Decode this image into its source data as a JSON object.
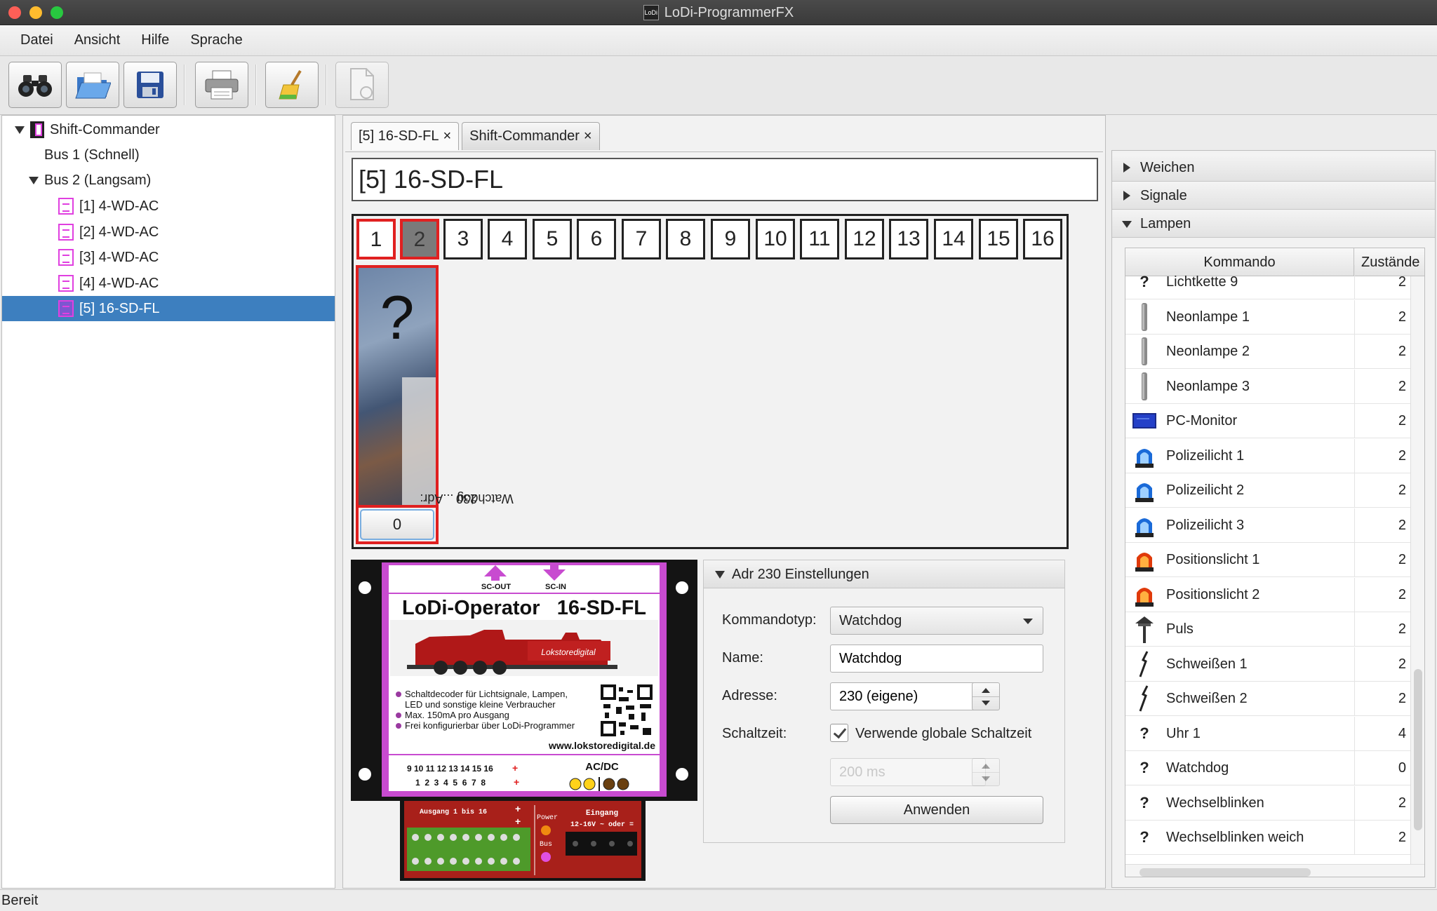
{
  "window": {
    "title": "LoDi-ProgrammerFX",
    "app_icon_text": "LoDi"
  },
  "menu": [
    "Datei",
    "Ansicht",
    "Hilfe",
    "Sprache"
  ],
  "toolbar": {
    "icons": [
      "binoculars-icon",
      "open-folder-icon",
      "save-disk-icon",
      "printer-icon",
      "broom-clean-icon",
      "document-refresh-icon"
    ]
  },
  "tree": [
    {
      "label": "Shift-Commander",
      "level": 0,
      "expanded": true
    },
    {
      "label": "Bus 1 (Schnell)",
      "level": 1
    },
    {
      "label": "Bus 2 (Langsam)",
      "level": 1,
      "expanded": true
    },
    {
      "label": "[1] 4-WD-AC",
      "level": 2
    },
    {
      "label": "[2] 4-WD-AC",
      "level": 2
    },
    {
      "label": "[3] 4-WD-AC",
      "level": 2
    },
    {
      "label": "[4] 4-WD-AC",
      "level": 2
    },
    {
      "label": "[5] 16-SD-FL",
      "level": 2,
      "selected": true
    }
  ],
  "tabs": [
    {
      "label": "[5] 16-SD-FL",
      "active": true,
      "close": "×"
    },
    {
      "label": "Shift-Commander",
      "active": false,
      "close": "×"
    }
  ],
  "module_title": "[5] 16-SD-FL",
  "channels": [
    "1",
    "2",
    "3",
    "4",
    "5",
    "6",
    "7",
    "8",
    "9",
    "10",
    "11",
    "12",
    "13",
    "14",
    "15",
    "16"
  ],
  "selected_channel": "1",
  "output": {
    "symbol": "?",
    "label_line1": "Watchdog ...Adr:",
    "label_line2": "230",
    "state_button": "0"
  },
  "product": {
    "sc_out": "SC-OUT",
    "sc_in": "SC-IN",
    "title": "LoDi-Operator   16-SD-FL",
    "brand": "Lokstoredigital",
    "bullets": [
      "Schaltdecoder für Lichtsignale, Lampen,",
      "LED und sonstige kleine Verbraucher",
      "Max. 150mA pro Ausgang",
      "Frei konfigurierbar über LoDi-Programmer"
    ],
    "url": "www.lokstoredigital.de",
    "pins_top": "9 10 11 12 13 14 15 16",
    "pins_bottom": "1  2  3  4  5  6  7  8",
    "acdc": "AC/DC",
    "ausgang": "Ausgang 1 bis 16",
    "power": "Power",
    "bus": "Bus",
    "eingang": "Eingang",
    "eingang_sub": "12-16V ~ oder ="
  },
  "settings": {
    "header": "Adr 230 Einstellungen",
    "kommandotyp_label": "Kommandotyp:",
    "kommandotyp_value": "Watchdog",
    "name_label": "Name:",
    "name_value": "Watchdog",
    "adresse_label": "Adresse:",
    "adresse_value": "230 (eigene)",
    "schaltzeit_label": "Schaltzeit:",
    "global_checkbox_label": "Verwende globale Schaltzeit",
    "global_checked": true,
    "schaltzeit_value": "200 ms",
    "apply_label": "Anwenden"
  },
  "right_panel": {
    "sections": [
      {
        "label": "Weichen",
        "expanded": false
      },
      {
        "label": "Signale",
        "expanded": false
      },
      {
        "label": "Lampen",
        "expanded": true
      }
    ],
    "columns": [
      "Kommando",
      "Zustände"
    ],
    "rows": [
      {
        "icon": "question-icon",
        "name": "Lichtkette 9",
        "states": "2"
      },
      {
        "icon": "neon-tube-icon",
        "name": "Neonlampe 1",
        "states": "2"
      },
      {
        "icon": "neon-tube-icon",
        "name": "Neonlampe 2",
        "states": "2"
      },
      {
        "icon": "neon-tube-icon",
        "name": "Neonlampe 3",
        "states": "2"
      },
      {
        "icon": "monitor-icon",
        "name": "PC-Monitor",
        "states": "2"
      },
      {
        "icon": "police-light-icon",
        "name": "Polizeilicht 1",
        "states": "2"
      },
      {
        "icon": "police-light-icon",
        "name": "Polizeilicht 2",
        "states": "2"
      },
      {
        "icon": "police-light-icon",
        "name": "Polizeilicht 3",
        "states": "2"
      },
      {
        "icon": "position-light-icon",
        "name": "Positionslicht 1",
        "states": "2"
      },
      {
        "icon": "position-light-icon",
        "name": "Positionslicht 2",
        "states": "2"
      },
      {
        "icon": "street-lamp-icon",
        "name": "Puls",
        "states": "2"
      },
      {
        "icon": "welding-icon",
        "name": "Schweißen 1",
        "states": "2"
      },
      {
        "icon": "welding-icon",
        "name": "Schweißen 2",
        "states": "2"
      },
      {
        "icon": "question-icon",
        "name": "Uhr 1",
        "states": "4"
      },
      {
        "icon": "question-icon",
        "name": "Watchdog",
        "states": "0"
      },
      {
        "icon": "question-icon",
        "name": "Wechselblinken",
        "states": "2"
      },
      {
        "icon": "question-icon",
        "name": "Wechselblinken weich",
        "states": "2"
      }
    ]
  },
  "status": {
    "text": "Bereit"
  },
  "colors": {
    "selection": "#3d7fbf",
    "channel_border": "#e02020",
    "board_magenta": "#c84bd0",
    "board_red": "#a8201a"
  }
}
